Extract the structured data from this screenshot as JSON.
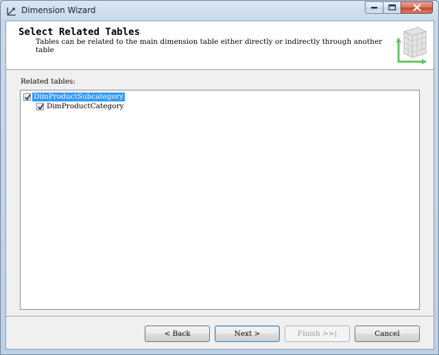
{
  "window": {
    "title": "Dimension Wizard"
  },
  "header": {
    "title": "Select Related Tables",
    "description": "Tables can be related to the main dimension table either directly or indirectly through another table"
  },
  "main": {
    "related_label": "Related tables:",
    "tree": [
      {
        "label": "DimProductSubcategory",
        "checked": true,
        "selected": true
      },
      {
        "label": "DimProductCategory",
        "checked": true,
        "selected": false
      }
    ]
  },
  "buttons": {
    "back": "< Back",
    "next": "Next >",
    "finish": "Finish >>|",
    "cancel": "Cancel"
  },
  "colors": {
    "selection": "#3399ff",
    "close_button": "#c4462e",
    "graphic_accent": "#5cc75c"
  }
}
